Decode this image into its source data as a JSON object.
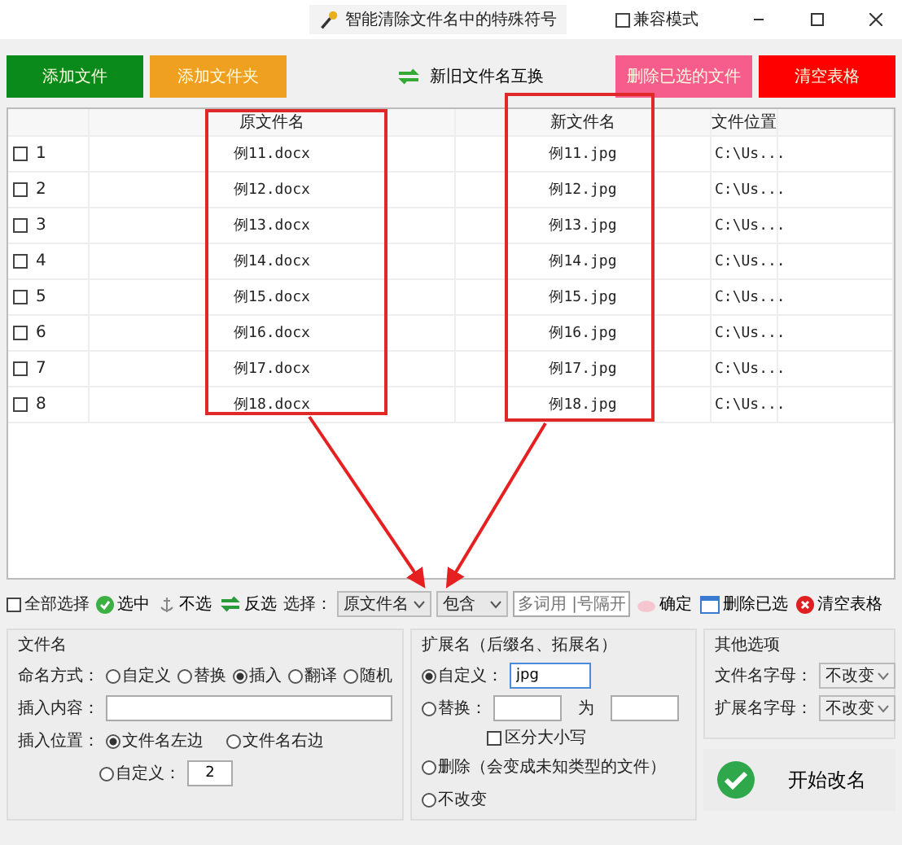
{
  "title_bar": {
    "title": "智能清除文件名中的特殊符号",
    "compat_mode": {
      "label": "兼容模式",
      "checked": false
    }
  },
  "top_buttons": [
    {
      "label": "添加文件",
      "color": "#0b8a1c"
    },
    {
      "label": "添加文件夹",
      "color": "#f0a020"
    },
    {
      "label": "删除已选的文件",
      "color": "#f75d8c"
    },
    {
      "label": "清空表格",
      "color": "#ff0000"
    }
  ],
  "swap_button": {
    "label": "新旧文件名互换"
  },
  "table": {
    "columns": [
      "原文件名",
      "新文件名",
      "文件位置"
    ],
    "rows": [
      {
        "number": "1",
        "checked": false,
        "original": "例11.docx",
        "new": "例11.jpg",
        "location": "C:\\Us..."
      },
      {
        "number": "2",
        "checked": false,
        "original": "例12.docx",
        "new": "例12.jpg",
        "location": "C:\\Us..."
      },
      {
        "number": "3",
        "checked": false,
        "original": "例13.docx",
        "new": "例13.jpg",
        "location": "C:\\Us..."
      },
      {
        "number": "4",
        "checked": false,
        "original": "例14.docx",
        "new": "例14.jpg",
        "location": "C:\\Us..."
      },
      {
        "number": "5",
        "checked": false,
        "original": "例15.docx",
        "new": "例15.jpg",
        "location": "C:\\Us..."
      },
      {
        "number": "6",
        "checked": false,
        "original": "例16.docx",
        "new": "例16.jpg",
        "location": "C:\\Us..."
      },
      {
        "number": "7",
        "checked": false,
        "original": "例17.docx",
        "new": "例17.jpg",
        "location": "C:\\Us..."
      },
      {
        "number": "8",
        "checked": false,
        "original": "例18.docx",
        "new": "例18.jpg",
        "location": "C:\\Us..."
      }
    ]
  },
  "toolbar": {
    "select_all": {
      "label": "全部选择",
      "checked": false
    },
    "actions": [
      {
        "kind": "check",
        "label": "选中"
      },
      {
        "kind": "uncheck",
        "label": "不选"
      },
      {
        "kind": "invert",
        "label": "反选"
      }
    ],
    "select_label": "选择：",
    "column_dropdown": "原文件名",
    "match_dropdown": "包含",
    "filter_placeholder": "多词用 |号隔开",
    "confirm": "确定",
    "delete_selected": "删除已选",
    "clear_table": "清空表格"
  },
  "filename_panel": {
    "title": "文件名",
    "naming_label": "命名方式：",
    "naming_options": [
      {
        "label": "自定义",
        "selected": false
      },
      {
        "label": "替换",
        "selected": false
      },
      {
        "label": "插入",
        "selected": true
      },
      {
        "label": "翻译",
        "selected": false
      },
      {
        "label": "随机",
        "selected": false
      }
    ],
    "insert_content_label": "插入内容：",
    "insert_position_label": "插入位置：",
    "position_options": [
      {
        "label": "文件名左边",
        "selected": true
      },
      {
        "label": "文件名右边",
        "selected": false
      }
    ],
    "custom_position": {
      "label": "自定义：",
      "selected": false,
      "value": "2"
    }
  },
  "extension_panel": {
    "title": "扩展名（后缀名、拓展名）",
    "custom": {
      "label": "自定义：",
      "selected": true,
      "value": "jpg"
    },
    "replace": {
      "label": "替换：",
      "selected": false,
      "with_label": "为"
    },
    "case_sensitive": {
      "label": "区分大小写",
      "checked": false
    },
    "delete": {
      "label": "删除（会变成未知类型的文件）",
      "selected": false
    },
    "unchanged": {
      "label": "不改变",
      "selected": false
    }
  },
  "other_panel": {
    "title": "其他选项",
    "fields": [
      {
        "label": "文件名字母：",
        "value": "不改变"
      },
      {
        "label": "扩展名字母：",
        "value": "不改变"
      }
    ]
  },
  "start_button": {
    "label": "开始改名"
  }
}
